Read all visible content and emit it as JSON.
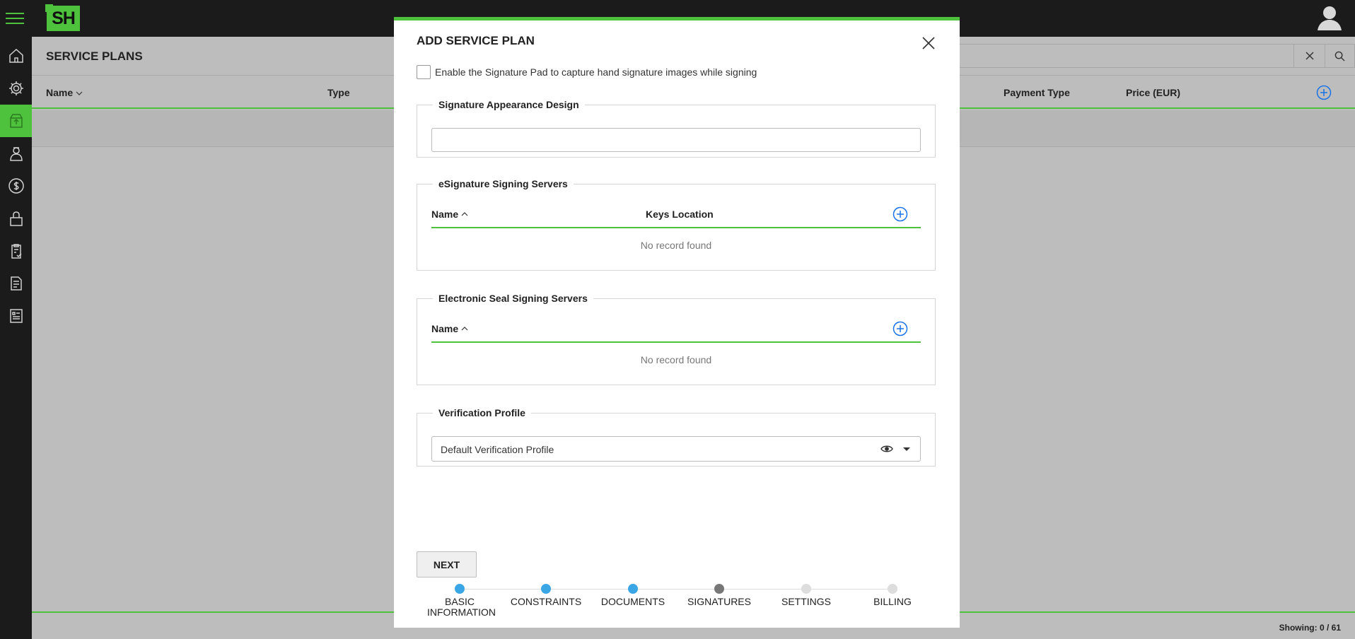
{
  "app": {
    "logo_text": "SH"
  },
  "page": {
    "title": "SERVICE PLANS",
    "columns": {
      "name": "Name",
      "type": "Type",
      "payment_type": "Payment Type",
      "price": "Price (EUR)"
    },
    "footer": {
      "showing": "Showing: 0 / 61"
    }
  },
  "modal": {
    "title": "ADD SERVICE PLAN",
    "signature_pad_label": "Enable the Signature Pad to capture hand signature images while signing",
    "signature_pad_checked": false,
    "appearance": {
      "legend": "Signature Appearance Design",
      "value": ""
    },
    "esign_servers": {
      "legend": "eSignature Signing Servers",
      "col_name": "Name",
      "col_keys": "Keys Location",
      "empty": "No record found"
    },
    "seal_servers": {
      "legend": "Electronic Seal Signing Servers",
      "col_name": "Name",
      "empty": "No record found"
    },
    "verification": {
      "legend": "Verification Profile",
      "selected": "Default Verification Profile"
    },
    "next_label": "NEXT",
    "steps": [
      {
        "label": "BASIC INFORMATION",
        "state": "done"
      },
      {
        "label": "CONSTRAINTS",
        "state": "done"
      },
      {
        "label": "DOCUMENTS",
        "state": "done"
      },
      {
        "label": "SIGNATURES",
        "state": "current"
      },
      {
        "label": "SETTINGS",
        "state": "todo"
      },
      {
        "label": "BILLING",
        "state": "todo"
      }
    ]
  },
  "colors": {
    "accent_green": "#4ec13d",
    "step_done": "#3aa6e6",
    "step_current": "#777777",
    "add_icon_blue": "#1a73e8"
  },
  "icons": {
    "menu": "hamburger-icon",
    "user": "user-avatar-icon",
    "sidebar": [
      "home-icon",
      "gear-icon",
      "upload-box-icon",
      "user-badge-icon",
      "dollar-icon",
      "lock-icon",
      "clipboard-check-icon",
      "document-icon",
      "report-icon"
    ]
  }
}
